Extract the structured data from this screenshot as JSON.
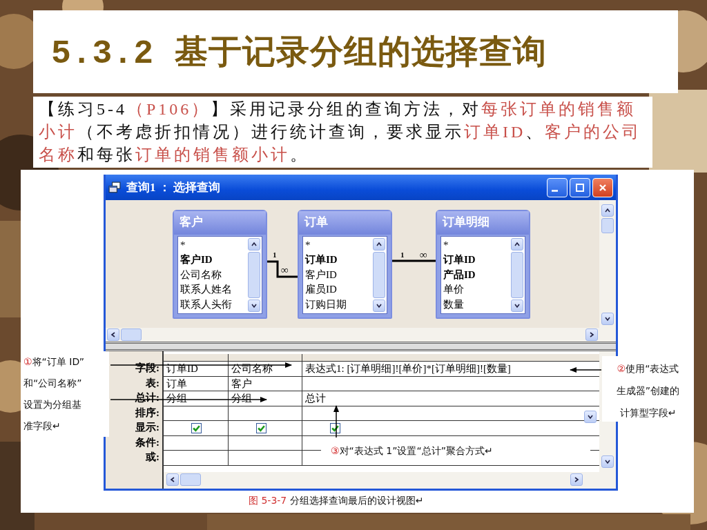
{
  "title": "5.3.2 基于记录分组的选择查询",
  "intro": [
    [
      {
        "text": "【练习5-4",
        "highlight": false
      },
      {
        "text": "（P106）",
        "highlight": true
      },
      {
        "text": "】采用记录分组的查询方法，对",
        "highlight": false
      },
      {
        "text": "每张订单的销售额",
        "highlight": true
      }
    ],
    [
      {
        "text": "小计",
        "highlight": true
      },
      {
        "text": "（不考虑折扣情况）进行统计查询，要求显示",
        "highlight": false
      },
      {
        "text": "订单ID",
        "highlight": true
      },
      {
        "text": "、",
        "highlight": false
      },
      {
        "text": "客户的公司",
        "highlight": true
      }
    ],
    [
      {
        "text": "名称",
        "highlight": true
      },
      {
        "text": "和每张",
        "highlight": false
      },
      {
        "text": "订单的销售额小计",
        "highlight": true
      },
      {
        "text": "。",
        "highlight": false
      }
    ]
  ],
  "window": {
    "title": "查询1 ： 选择查询",
    "tables": [
      {
        "name": "客户",
        "fields": [
          {
            "text": "*",
            "key": false
          },
          {
            "text": "客户ID",
            "key": true
          },
          {
            "text": "公司名称",
            "key": false
          },
          {
            "text": "联系人姓名",
            "key": false
          },
          {
            "text": "联系人头衔",
            "key": false
          }
        ]
      },
      {
        "name": "订单",
        "fields": [
          {
            "text": "*",
            "key": false
          },
          {
            "text": "订单ID",
            "key": true
          },
          {
            "text": "客户ID",
            "key": false
          },
          {
            "text": "雇员ID",
            "key": false
          },
          {
            "text": "订购日期",
            "key": false
          }
        ]
      },
      {
        "name": "订单明细",
        "fields": [
          {
            "text": "*",
            "key": false
          },
          {
            "text": "订单ID",
            "key": true
          },
          {
            "text": "产品ID",
            "key": true
          },
          {
            "text": "单价",
            "key": false
          },
          {
            "text": "数量",
            "key": false
          }
        ]
      }
    ],
    "relations": [
      {
        "one": "1",
        "many": "∞"
      },
      {
        "one": "1",
        "many": "∞"
      }
    ],
    "grid": {
      "row_labels": [
        "字段:",
        "表:",
        "总计:",
        "排序:",
        "显示:",
        "条件:",
        "或:"
      ],
      "columns": [
        {
          "field": "订单ID",
          "table": "订单",
          "total": "分组",
          "show": true
        },
        {
          "field": "公司名称",
          "table": "客户",
          "total": "分组",
          "show": true
        },
        {
          "field": "表达式1: [订单明细]![单价]*[订单明细]![数量]",
          "total": "总计",
          "show": true
        }
      ]
    }
  },
  "callouts": [
    {
      "number": "①",
      "lines": [
        "将“订单 ID”",
        "和“公司名称”",
        "设置为分组基",
        "准字段↵"
      ]
    },
    {
      "number": "②",
      "lines": [
        "使用“表达式",
        "生成器”创建的",
        "计算型字段↵"
      ]
    },
    {
      "number": "③",
      "lines": [
        "对“表达式 1”设置“总计”聚合方式↵"
      ]
    }
  ],
  "caption": {
    "number": "图 5-3-7",
    "text": "分组选择查询最后的设计视图↵"
  }
}
